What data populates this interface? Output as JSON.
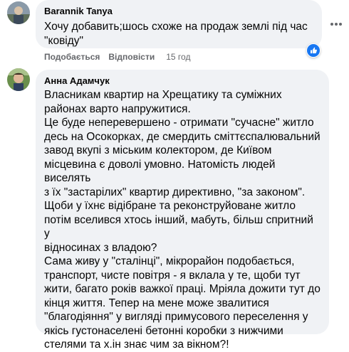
{
  "comments": [
    {
      "author": "Barannik Tanya",
      "text": "Хочу добавить;шось схоже на продаж землі під час\n\"ковіду\"",
      "actions": {
        "like": "Подобається",
        "reply": "Відповісти",
        "time": "15 год"
      },
      "reaction_icon": "like-icon"
    },
    {
      "author": "Анна Адамчук",
      "text": "Власникам квартир на Хрещатику та суміжних\nрайонах варто напружитися.\nЦе буде неперевершено - отримати \"сучасне\" житло\nдесь на Осокорках, де смердить сміттєспалювальний\nзавод вкупі з міським колектором, де Київом\nмісцевина є доволі умовно. Натомість людей виселять\nз їх \"застарілих\" квартир директивно, \"за законом\".\nЩоби у їхнє відібране та реконструйоване житло\nпотім вселився хтось інший, мабуть, більш спритний у\nвідносинах з владою?\nСама живу у \"сталінці\", мікрорайон подобається,\nтранспорт, чисте повітря - я вклала у те, щоби тут\nжити, багато років важкої праці. Мріяла дожити тут до\nкінця життя. Тепер на мене може звалитися\n\"благодіяння\" у вигляді примусового переселення у\nякісь густонаселені бетонні коробки з нижчими\nстелями та х.ін знає чим за вікном?!"
    }
  ],
  "colors": {
    "bubble": "#f0f2f5",
    "meta": "#65676b",
    "like_blue": "#1877f2"
  }
}
